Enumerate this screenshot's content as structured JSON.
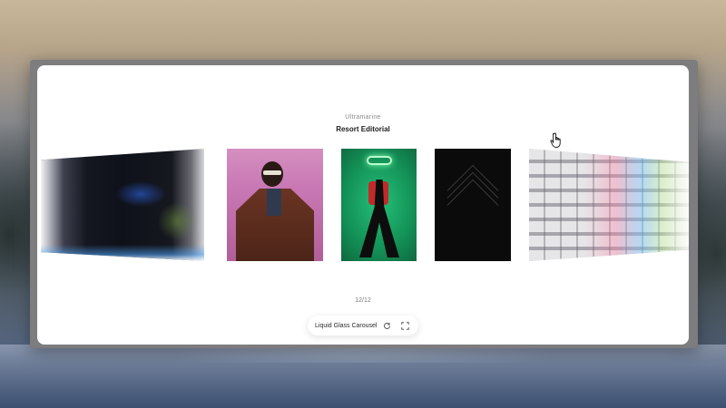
{
  "gallery": {
    "subtitle": "Ultramarine",
    "title": "Resort Editorial",
    "counter": "12/12",
    "cards": [
      {
        "description": "Distorted glass abstract"
      },
      {
        "description": "Man in leather jacket"
      },
      {
        "description": "Woman in green studio"
      },
      {
        "description": "Dark chevron"
      },
      {
        "description": "Building facade"
      }
    ]
  },
  "toolbar": {
    "label": "Liquid Glass Carousel",
    "refresh_icon": "refresh-icon",
    "fullscreen_icon": "fullscreen-icon"
  },
  "colors": {
    "accent": "#1d1d1d",
    "panel": "#ffffff"
  }
}
